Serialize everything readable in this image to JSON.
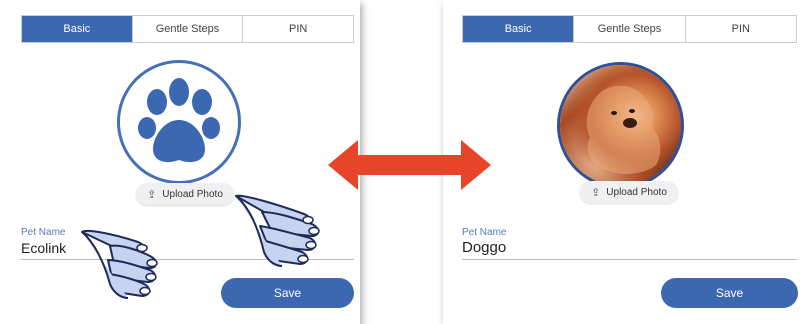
{
  "left_panel": {
    "tabs": [
      {
        "label": "Basic",
        "active": true
      },
      {
        "label": "Gentle Steps",
        "active": false
      },
      {
        "label": "PIN",
        "active": false
      }
    ],
    "avatar_icon": "paw-icon",
    "upload_label": "Upload Photo",
    "pet_name_label": "Pet Name",
    "pet_name_value": "Ecolink",
    "save_label": "Save"
  },
  "right_panel": {
    "tabs": [
      {
        "label": "Basic",
        "active": true
      },
      {
        "label": "Gentle Steps",
        "active": false
      },
      {
        "label": "PIN",
        "active": false
      }
    ],
    "avatar_icon": "dog-photo",
    "upload_label": "Upload Photo",
    "pet_name_label": "Pet Name",
    "pet_name_value": "Doggo",
    "save_label": "Save"
  },
  "annotations": {
    "arrow_color": "#e8442a",
    "hand_color": "#c7d4f0",
    "hand_outline": "#1d2a5a",
    "accent_color": "#3c67b1"
  }
}
